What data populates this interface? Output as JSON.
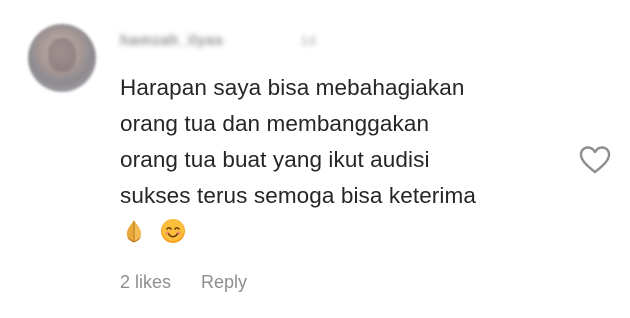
{
  "comment": {
    "username": "hamzah_ilyas",
    "timestamp": "1d",
    "lines": [
      "Harapan saya bisa mebahagiakan",
      "orang tua dan membanggakan",
      "orang tua buat yang ikut audisi",
      "sukses terus semoga bisa keterima"
    ],
    "emojis": [
      "pray-hands-emoji",
      "smiling-face-emoji"
    ],
    "likes_label": "2 likes",
    "reply_label": "Reply"
  },
  "colors": {
    "text": "#262626",
    "muted": "#8e8e8e",
    "icon_stroke": "#8e8e8e",
    "emoji_gold": "#e9a93b",
    "emoji_face": "#f6a21e"
  },
  "icons": {
    "like": "heart-outline-icon"
  }
}
